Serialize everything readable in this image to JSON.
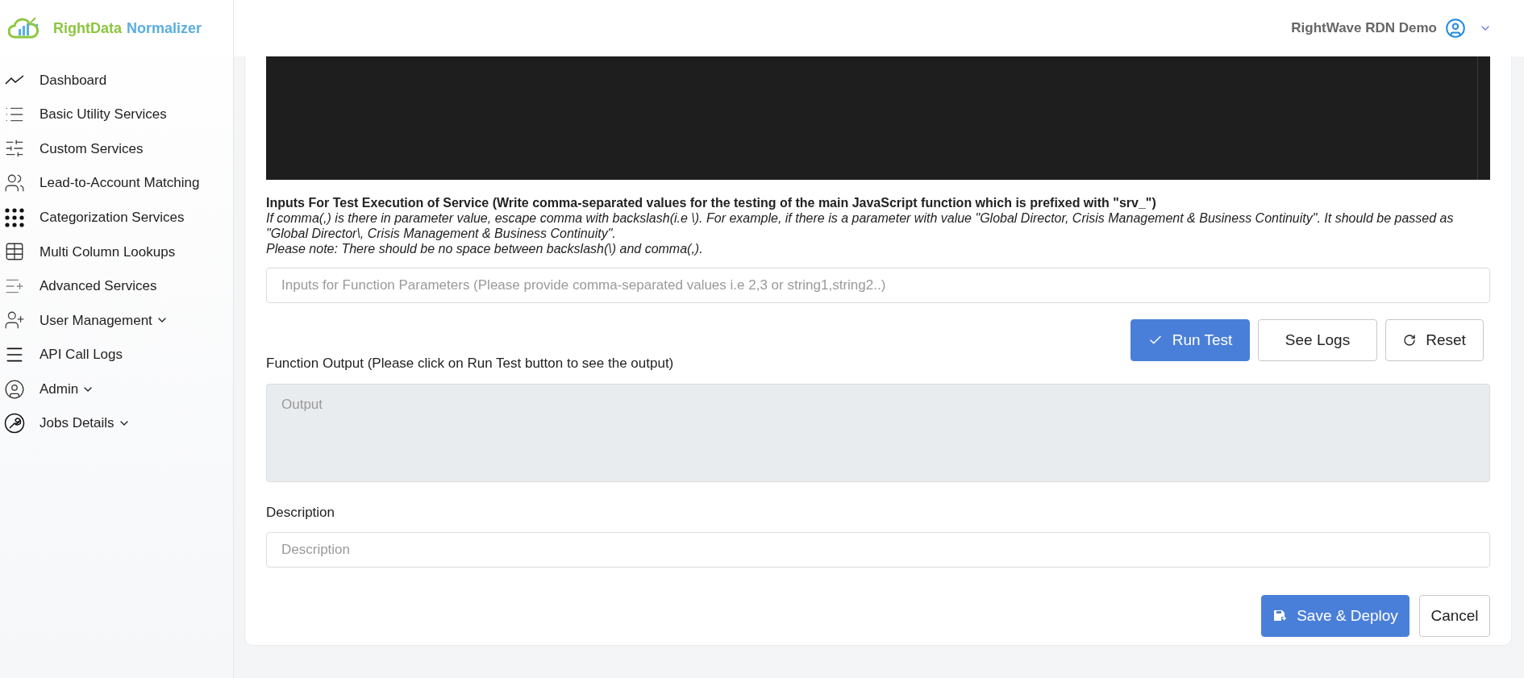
{
  "brand": {
    "primary": "RightData",
    "secondary": "Normalizer"
  },
  "sidebar": {
    "items": [
      {
        "label": "Dashboard",
        "kind": "link"
      },
      {
        "label": "Basic Utility Services",
        "kind": "link"
      },
      {
        "label": "Custom Services",
        "kind": "link"
      },
      {
        "label": "Lead-to-Account Matching",
        "kind": "link"
      },
      {
        "label": "Categorization Services",
        "kind": "link"
      },
      {
        "label": "Multi Column Lookups",
        "kind": "link"
      },
      {
        "label": "Advanced Services",
        "kind": "link"
      },
      {
        "label": "User Management",
        "kind": "group"
      },
      {
        "label": "API Call Logs",
        "kind": "link"
      },
      {
        "label": "Admin",
        "kind": "group"
      },
      {
        "label": "Jobs Details",
        "kind": "group"
      }
    ]
  },
  "header": {
    "user_name": "RightWave RDN Demo"
  },
  "test_inputs": {
    "heading": "Inputs For Test Execution of Service (Write comma-separated values for the testing of the main JavaScript function which is prefixed with \"srv_\")",
    "note": "If comma(,) is there in parameter value, escape comma with backslash(i.e \\). For example, if there is a parameter with value \"Global Director, Crisis Management & Business Continuity\". It should be passed as \"Global Director\\, Crisis Management & Business Continuity\".",
    "note_2": "Please note: There should be no space between backslash(\\) and comma(,).",
    "placeholder": "Inputs for Function Parameters (Please provide comma-separated values i.e 2,3 or string1,string2..)"
  },
  "actions": [
    {
      "label": "Run Test",
      "kind": "primary"
    },
    {
      "label": "See Logs",
      "kind": "outline"
    },
    {
      "label": "Reset",
      "kind": "outline"
    }
  ],
  "output": {
    "label": "Function Output (Please click on Run Test button to see the output)",
    "placeholder": "Output"
  },
  "description": {
    "label": "Description",
    "placeholder": "Description"
  },
  "footer_buttons": [
    {
      "label": "Save & Deploy",
      "kind": "primary"
    },
    {
      "label": "Cancel",
      "kind": "outline"
    }
  ]
}
